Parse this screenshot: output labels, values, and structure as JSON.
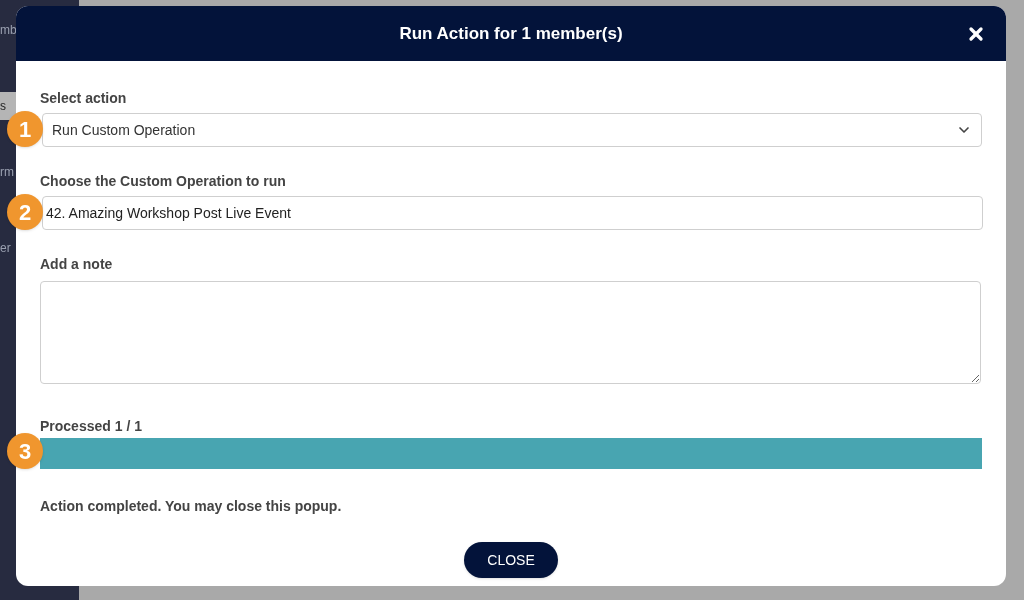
{
  "background": {
    "sidebar_items": [
      {
        "label": "mb",
        "selected": false
      },
      {
        "label": "s",
        "selected": true
      },
      {
        "label": "rm",
        "selected": false
      },
      {
        "label": "er",
        "selected": false
      }
    ]
  },
  "dialog": {
    "title": "Run Action for 1 member(s)",
    "fields": [
      {
        "kind": "select",
        "label": "Select action",
        "value": "Run Custom Operation",
        "badge": "1"
      },
      {
        "kind": "text",
        "label": "Choose the Custom Operation to run",
        "value": "42. Amazing Workshop Post Live Event",
        "badge": "2"
      },
      {
        "kind": "textarea",
        "label": "Add a note"
      }
    ],
    "progress": {
      "label": "Processed 1 / 1",
      "level": 1,
      "badge": "3"
    },
    "message": "Action completed. You may close this popup.",
    "button": "CLOSE"
  }
}
